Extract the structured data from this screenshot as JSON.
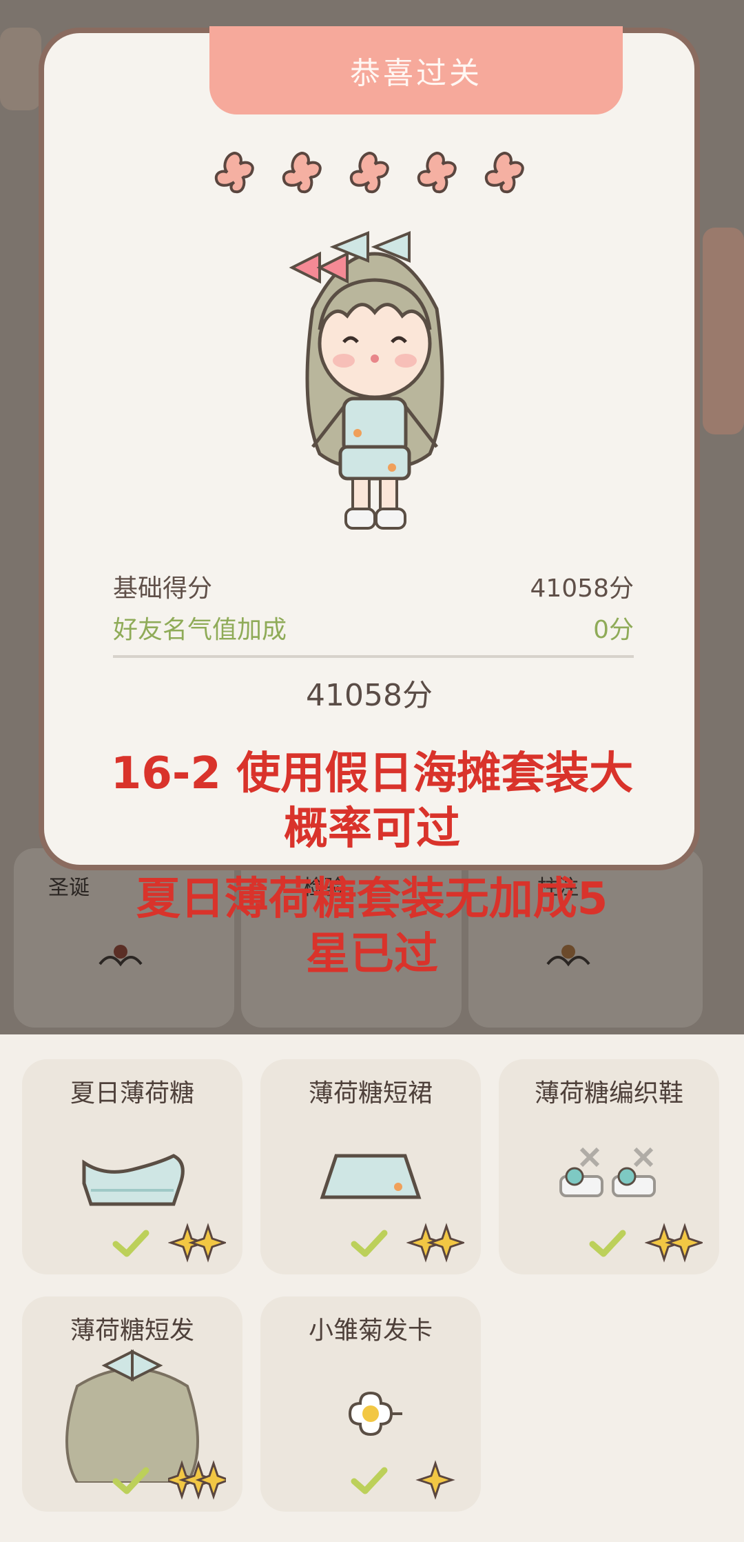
{
  "dialog": {
    "title": "恭喜过关",
    "stars_earned": 5,
    "stars_total": 5,
    "base_score_label": "基础得分",
    "base_score_value": "41058分",
    "bonus_label": "好友名气值加成",
    "bonus_value": "0分",
    "total_score": "41058分"
  },
  "overlay": {
    "line1": "16-2 使用假日海摊套装大",
    "line2": "概率可过",
    "line3": "夏日薄荷糖套装无加成5",
    "line4": "星已过"
  },
  "background_labels": [
    "圣诞",
    "检验",
    "柱注"
  ],
  "items": [
    {
      "name": "夏日薄荷糖",
      "icon": "mint-top-icon"
    },
    {
      "name": "薄荷糖短裙",
      "icon": "mint-skirt-icon"
    },
    {
      "name": "薄荷糖编织鞋",
      "icon": "mint-shoes-icon"
    },
    {
      "name": "薄荷糖短发",
      "icon": "mint-hair-icon"
    },
    {
      "name": "小雏菊发卡",
      "icon": "daisy-clip-icon"
    }
  ],
  "colors": {
    "ribbon": "#f6a99b",
    "star": "#f5b0a2",
    "check": "#bcd05a",
    "sparkle": "#f2c744",
    "overlay_text": "#d9332b"
  }
}
